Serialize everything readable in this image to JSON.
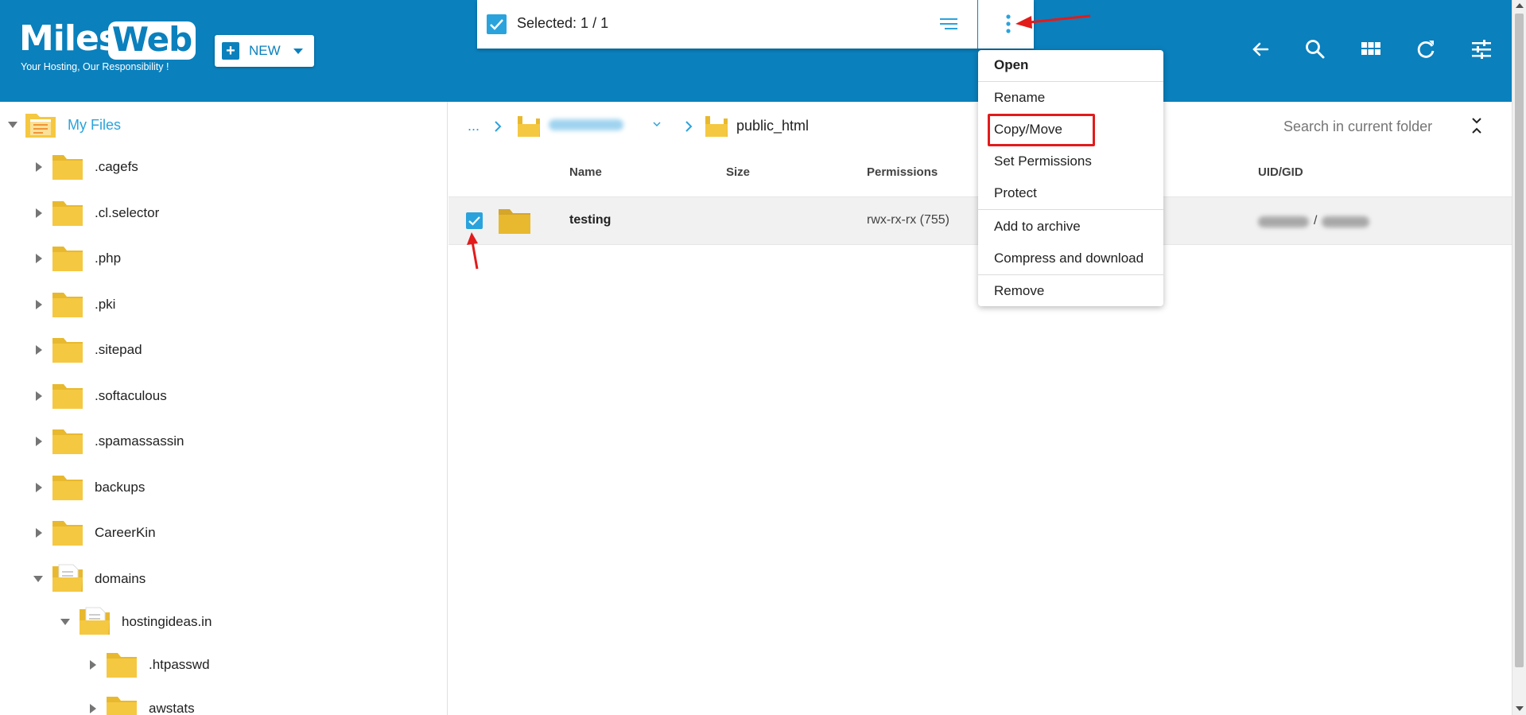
{
  "brand": {
    "logo_left": "Miles",
    "logo_right": "Web",
    "tagline": "Your Hosting, Our Responsibility !"
  },
  "toolbar": {
    "new_label": "NEW",
    "selected_text": "Selected: 1 / 1",
    "icons": [
      "back-arrow-icon",
      "search-icon",
      "grid-view-icon",
      "refresh-icon",
      "settings-sliders-icon"
    ]
  },
  "tree": {
    "root_label": "My Files",
    "items": [
      {
        "label": ".cagefs"
      },
      {
        "label": ".cl.selector"
      },
      {
        "label": ".php"
      },
      {
        "label": ".pki"
      },
      {
        "label": ".sitepad"
      },
      {
        "label": ".softaculous"
      },
      {
        "label": ".spamassassin"
      },
      {
        "label": "backups"
      },
      {
        "label": "CareerKin"
      },
      {
        "label": "domains"
      },
      {
        "label": "hostingideas.in"
      },
      {
        "label": ".htpasswd"
      },
      {
        "label": "awstats"
      }
    ]
  },
  "breadcrumb": {
    "dots": "...",
    "current": "public_html"
  },
  "search": {
    "placeholder": "Search in current folder"
  },
  "table": {
    "columns": [
      "Name",
      "Size",
      "Permissions",
      "UID/GID"
    ],
    "rows": [
      {
        "name": "testing",
        "size": "",
        "permissions": "rwx-rx-rx (755)",
        "uid_sep": "/"
      }
    ]
  },
  "context_menu": {
    "items": [
      "Open",
      "Rename",
      "Copy/Move",
      "Set Permissions",
      "Protect",
      "Add to archive",
      "Compress and download",
      "Remove"
    ],
    "highlighted": "Copy/Move"
  },
  "colors": {
    "header_bg": "#0a80bd",
    "accent": "#2aa3dc",
    "folder": "#f5c842",
    "annotation_red": "#e21b1b"
  }
}
